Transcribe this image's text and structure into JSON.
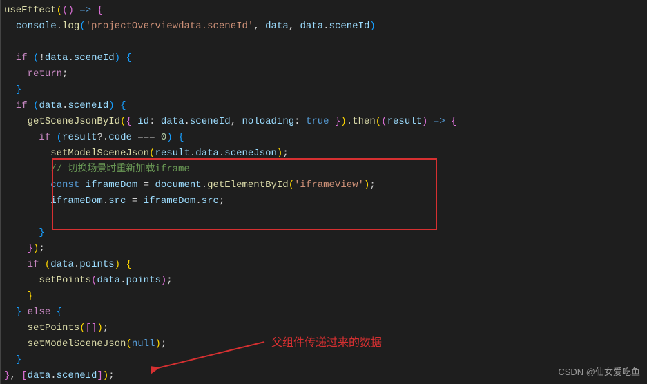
{
  "code_lines": [
    {
      "parts": [
        {
          "t": "useEffect",
          "c": "tok-fn"
        },
        {
          "t": "(",
          "c": "tok-gold"
        },
        {
          "t": "(",
          "c": "tok-purple"
        },
        {
          "t": ") ",
          "c": "tok-purple"
        },
        {
          "t": "=>",
          "c": "tok-kwblue"
        },
        {
          "t": " {",
          "c": "tok-purple"
        }
      ]
    },
    {
      "parts": [
        {
          "t": "  ",
          "c": ""
        },
        {
          "t": "console",
          "c": "tok-var"
        },
        {
          "t": ".",
          "c": "tok-punct"
        },
        {
          "t": "log",
          "c": "tok-fn"
        },
        {
          "t": "(",
          "c": "tok-cyansq"
        },
        {
          "t": "'projectOverviewdata.sceneId'",
          "c": "tok-str"
        },
        {
          "t": ", ",
          "c": "tok-punct"
        },
        {
          "t": "data",
          "c": "tok-var"
        },
        {
          "t": ", ",
          "c": "tok-punct"
        },
        {
          "t": "data",
          "c": "tok-var"
        },
        {
          "t": ".",
          "c": "tok-punct"
        },
        {
          "t": "sceneId",
          "c": "tok-prop"
        },
        {
          "t": ")",
          "c": "tok-cyansq"
        }
      ]
    },
    {
      "parts": [
        {
          "t": " ",
          "c": ""
        }
      ]
    },
    {
      "parts": [
        {
          "t": "  ",
          "c": ""
        },
        {
          "t": "if",
          "c": "tok-kw"
        },
        {
          "t": " (",
          "c": "tok-cyansq"
        },
        {
          "t": "!",
          "c": "tok-punct"
        },
        {
          "t": "data",
          "c": "tok-var"
        },
        {
          "t": ".",
          "c": "tok-punct"
        },
        {
          "t": "sceneId",
          "c": "tok-prop"
        },
        {
          "t": ")",
          "c": "tok-cyansq"
        },
        {
          "t": " {",
          "c": "tok-cyansq"
        }
      ]
    },
    {
      "parts": [
        {
          "t": "    ",
          "c": ""
        },
        {
          "t": "return",
          "c": "tok-kw"
        },
        {
          "t": ";",
          "c": "tok-punct"
        }
      ]
    },
    {
      "parts": [
        {
          "t": "  ",
          "c": ""
        },
        {
          "t": "}",
          "c": "tok-cyansq"
        }
      ]
    },
    {
      "parts": [
        {
          "t": "  ",
          "c": ""
        },
        {
          "t": "if",
          "c": "tok-kw"
        },
        {
          "t": " (",
          "c": "tok-cyansq"
        },
        {
          "t": "data",
          "c": "tok-var"
        },
        {
          "t": ".",
          "c": "tok-punct"
        },
        {
          "t": "sceneId",
          "c": "tok-prop"
        },
        {
          "t": ")",
          "c": "tok-cyansq"
        },
        {
          "t": " {",
          "c": "tok-cyansq"
        }
      ]
    },
    {
      "parts": [
        {
          "t": "    ",
          "c": ""
        },
        {
          "t": "getSceneJsonById",
          "c": "tok-fn"
        },
        {
          "t": "(",
          "c": "tok-gold"
        },
        {
          "t": "{ ",
          "c": "tok-purple"
        },
        {
          "t": "id",
          "c": "tok-prop"
        },
        {
          "t": ":",
          "c": "tok-punct"
        },
        {
          "t": " data",
          "c": "tok-var"
        },
        {
          "t": ".",
          "c": "tok-punct"
        },
        {
          "t": "sceneId",
          "c": "tok-prop"
        },
        {
          "t": ", ",
          "c": "tok-punct"
        },
        {
          "t": "noloading",
          "c": "tok-prop"
        },
        {
          "t": ":",
          "c": "tok-punct"
        },
        {
          "t": " true",
          "c": "tok-bool"
        },
        {
          "t": " }",
          "c": "tok-purple"
        },
        {
          "t": ")",
          "c": "tok-gold"
        },
        {
          "t": ".",
          "c": "tok-punct"
        },
        {
          "t": "then",
          "c": "tok-fn"
        },
        {
          "t": "(",
          "c": "tok-gold"
        },
        {
          "t": "(",
          "c": "tok-purple"
        },
        {
          "t": "result",
          "c": "tok-param"
        },
        {
          "t": ")",
          "c": "tok-purple"
        },
        {
          "t": " =>",
          "c": "tok-kwblue"
        },
        {
          "t": " {",
          "c": "tok-purple"
        }
      ]
    },
    {
      "parts": [
        {
          "t": "      ",
          "c": ""
        },
        {
          "t": "if",
          "c": "tok-kw"
        },
        {
          "t": " (",
          "c": "tok-cyansq"
        },
        {
          "t": "result",
          "c": "tok-var"
        },
        {
          "t": "?.",
          "c": "tok-punct"
        },
        {
          "t": "code",
          "c": "tok-prop"
        },
        {
          "t": " === ",
          "c": "tok-punct"
        },
        {
          "t": "0",
          "c": "tok-num"
        },
        {
          "t": ")",
          "c": "tok-cyansq"
        },
        {
          "t": " {",
          "c": "tok-cyansq"
        }
      ]
    },
    {
      "parts": [
        {
          "t": "        ",
          "c": ""
        },
        {
          "t": "setModelSceneJson",
          "c": "tok-fn"
        },
        {
          "t": "(",
          "c": "tok-gold"
        },
        {
          "t": "result",
          "c": "tok-var"
        },
        {
          "t": ".",
          "c": "tok-punct"
        },
        {
          "t": "data",
          "c": "tok-prop"
        },
        {
          "t": ".",
          "c": "tok-punct"
        },
        {
          "t": "sceneJson",
          "c": "tok-prop"
        },
        {
          "t": ")",
          "c": "tok-gold"
        },
        {
          "t": ";",
          "c": "tok-punct"
        }
      ]
    },
    {
      "parts": [
        {
          "t": "        ",
          "c": ""
        },
        {
          "t": "// 切换场景时重新加载iframe",
          "c": "tok-comment"
        }
      ]
    },
    {
      "parts": [
        {
          "t": "        ",
          "c": ""
        },
        {
          "t": "const",
          "c": "tok-kwblue"
        },
        {
          "t": " iframeDom",
          "c": "tok-var"
        },
        {
          "t": " = ",
          "c": "tok-punct"
        },
        {
          "t": "document",
          "c": "tok-var"
        },
        {
          "t": ".",
          "c": "tok-punct"
        },
        {
          "t": "getElementById",
          "c": "tok-fn"
        },
        {
          "t": "(",
          "c": "tok-gold"
        },
        {
          "t": "'iframeView'",
          "c": "tok-str"
        },
        {
          "t": ")",
          "c": "tok-gold"
        },
        {
          "t": ";",
          "c": "tok-punct"
        }
      ]
    },
    {
      "parts": [
        {
          "t": "        ",
          "c": ""
        },
        {
          "t": "iframeDom",
          "c": "tok-var"
        },
        {
          "t": ".",
          "c": "tok-punct"
        },
        {
          "t": "src",
          "c": "tok-prop"
        },
        {
          "t": " = ",
          "c": "tok-punct"
        },
        {
          "t": "iframeDom",
          "c": "tok-var"
        },
        {
          "t": ".",
          "c": "tok-punct"
        },
        {
          "t": "src",
          "c": "tok-prop"
        },
        {
          "t": ";",
          "c": "tok-punct"
        }
      ]
    },
    {
      "parts": [
        {
          "t": " ",
          "c": ""
        }
      ]
    },
    {
      "parts": [
        {
          "t": "      ",
          "c": ""
        },
        {
          "t": "}",
          "c": "tok-cyansq"
        }
      ]
    },
    {
      "parts": [
        {
          "t": "    ",
          "c": ""
        },
        {
          "t": "}",
          "c": "tok-purple"
        },
        {
          "t": ")",
          "c": "tok-gold"
        },
        {
          "t": ";",
          "c": "tok-punct"
        }
      ]
    },
    {
      "parts": [
        {
          "t": "    ",
          "c": ""
        },
        {
          "t": "if",
          "c": "tok-kw"
        },
        {
          "t": " (",
          "c": "tok-gold"
        },
        {
          "t": "data",
          "c": "tok-var"
        },
        {
          "t": ".",
          "c": "tok-punct"
        },
        {
          "t": "points",
          "c": "tok-prop"
        },
        {
          "t": ")",
          "c": "tok-gold"
        },
        {
          "t": " {",
          "c": "tok-gold"
        }
      ]
    },
    {
      "parts": [
        {
          "t": "      ",
          "c": ""
        },
        {
          "t": "setPoints",
          "c": "tok-fn"
        },
        {
          "t": "(",
          "c": "tok-purple"
        },
        {
          "t": "data",
          "c": "tok-var"
        },
        {
          "t": ".",
          "c": "tok-punct"
        },
        {
          "t": "points",
          "c": "tok-prop"
        },
        {
          "t": ")",
          "c": "tok-purple"
        },
        {
          "t": ";",
          "c": "tok-punct"
        }
      ]
    },
    {
      "parts": [
        {
          "t": "    ",
          "c": ""
        },
        {
          "t": "}",
          "c": "tok-gold"
        }
      ]
    },
    {
      "parts": [
        {
          "t": "  ",
          "c": ""
        },
        {
          "t": "}",
          "c": "tok-cyansq"
        },
        {
          "t": " else",
          "c": "tok-kw"
        },
        {
          "t": " {",
          "c": "tok-cyansq"
        }
      ]
    },
    {
      "parts": [
        {
          "t": "    ",
          "c": ""
        },
        {
          "t": "setPoints",
          "c": "tok-fn"
        },
        {
          "t": "(",
          "c": "tok-gold"
        },
        {
          "t": "[]",
          "c": "tok-purple"
        },
        {
          "t": ")",
          "c": "tok-gold"
        },
        {
          "t": ";",
          "c": "tok-punct"
        }
      ]
    },
    {
      "parts": [
        {
          "t": "    ",
          "c": ""
        },
        {
          "t": "setModelSceneJson",
          "c": "tok-fn"
        },
        {
          "t": "(",
          "c": "tok-gold"
        },
        {
          "t": "null",
          "c": "tok-bool"
        },
        {
          "t": ")",
          "c": "tok-gold"
        },
        {
          "t": ";",
          "c": "tok-punct"
        }
      ]
    },
    {
      "parts": [
        {
          "t": "  ",
          "c": ""
        },
        {
          "t": "}",
          "c": "tok-cyansq"
        }
      ]
    },
    {
      "parts": [
        {
          "t": "}",
          "c": "tok-purple"
        },
        {
          "t": ", ",
          "c": "tok-punct"
        },
        {
          "t": "[",
          "c": "tok-purple"
        },
        {
          "t": "data",
          "c": "tok-var"
        },
        {
          "t": ".",
          "c": "tok-punct"
        },
        {
          "t": "sceneId",
          "c": "tok-prop"
        },
        {
          "t": "]",
          "c": "tok-purple"
        },
        {
          "t": ")",
          "c": "tok-gold"
        },
        {
          "t": ";",
          "c": "tok-punct"
        }
      ]
    }
  ],
  "annotation": "父组件传递过来的数据",
  "watermark": "CSDN @仙女爱吃鱼"
}
